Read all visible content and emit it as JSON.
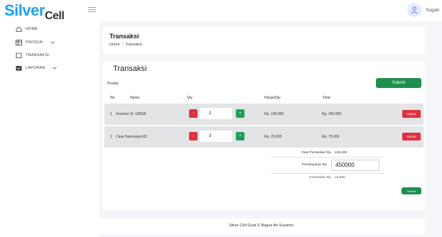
{
  "brand": {
    "name_main": "Silver",
    "name_cell": "Cell",
    "color": "#1aa3e8"
  },
  "user": {
    "name": "Sugab"
  },
  "sidebar": {
    "items": [
      {
        "label": "HOME",
        "icon": "home-icon"
      },
      {
        "label": "PRODUK",
        "icon": "table-icon",
        "has_submenu": true
      },
      {
        "label": "TRANSAKSI",
        "icon": "cart-icon"
      },
      {
        "label": "LAPORAN",
        "icon": "clipboard-icon",
        "has_submenu": true
      }
    ]
  },
  "header": {
    "title": "Transaksi",
    "breadcrumb": [
      "Home",
      "Transaksi"
    ]
  },
  "main": {
    "title": "Transaksi",
    "produk_label": "Produk",
    "submit_label": "Submit",
    "columns": [
      "No",
      "Nama",
      "Qty",
      "Harga/Qty",
      "Total"
    ],
    "rows": [
      {
        "no": "1",
        "nama": "Voucher XL 100GB",
        "qty": "2",
        "harga": "Rp. 180.000",
        "total": "Rp. 360.000",
        "delete_label": "Hapus"
      },
      {
        "no": "2",
        "nama": "Case Samsung A32",
        "qty": "3",
        "harga": "Rp. 25.000",
        "total": "Rp. 75.000",
        "delete_label": "Hapus"
      }
    ],
    "minus_symbol": "-",
    "plus_symbol": "+",
    "summary": {
      "total_label": "Total Pembelian Rp.",
      "total_value": "435,000",
      "payment_label": "Pembayaran Rp.",
      "payment_value": "450000",
      "change_label": "Kembalian Rp.",
      "change_value": "15,000"
    },
    "submit_bottom_label": "Submit"
  },
  "footer": {
    "text": "Silver Cell Grub © Bagus Ari Susanto"
  },
  "colors": {
    "green": "#1e8f4f",
    "red": "#e0313f",
    "row_bg": "#e3e4e6",
    "page_bg": "#f4f6f9"
  }
}
